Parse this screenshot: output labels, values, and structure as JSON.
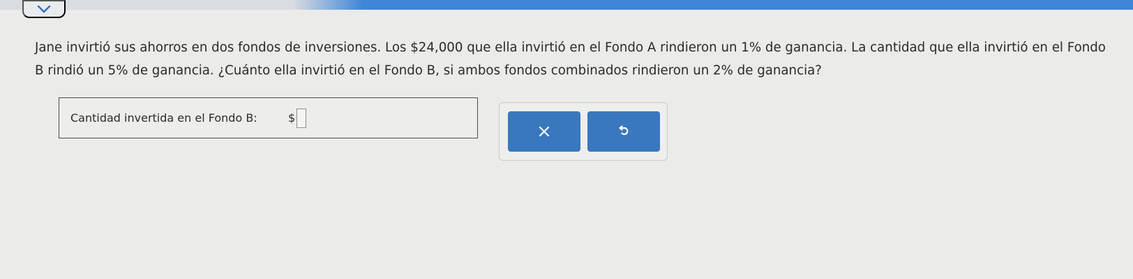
{
  "navigation": {
    "collapse_icon": "chevron-down-icon"
  },
  "question": {
    "text": "Jane invirtió sus ahorros en dos fondos de inversiones. Los $24,000 que ella invirtió en el Fondo A rindieron un 1% de ganancia. La cantidad que ella invirtió en el Fondo B rindió un 5% de ganancia. ¿Cuánto ella invirtió en el Fondo B, si ambos fondos combinados rindieron un 2% de ganancia?"
  },
  "answer": {
    "label": "Cantidad invertida en el Fondo B:",
    "currency_symbol": "$",
    "value": "",
    "placeholder": ""
  },
  "actions": {
    "clear_icon": "close-icon",
    "undo_icon": "undo-icon"
  },
  "colors": {
    "top_bar_blue": "#3f86d6",
    "button_blue": "#3978be",
    "background": "#ebebe9"
  }
}
